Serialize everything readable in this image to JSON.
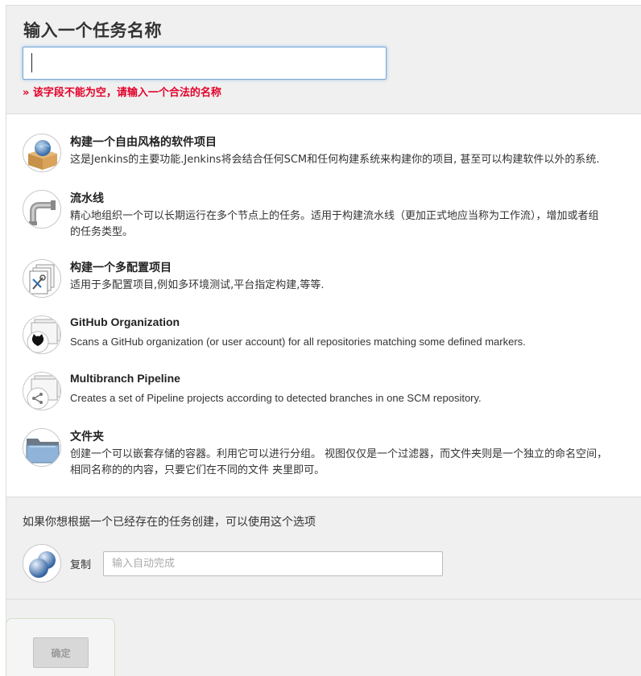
{
  "header": {
    "title": "输入一个任务名称",
    "name_input_value": "",
    "error": "» 该字段不能为空，请输入一个合法的名称"
  },
  "items": [
    {
      "name": "构建一个自由风格的软件项目",
      "description": "这是Jenkins的主要功能.Jenkins将会结合任何SCM和任何构建系统来构建你的项目, 甚至可以构建软件以外的系统.",
      "icon": "freestyle-box-icon"
    },
    {
      "name": "流水线",
      "description": "精心地组织一个可以长期运行在多个节点上的任务。适用于构建流水线（更加正式地应当称为工作流），增加或者组\n的任务类型。",
      "icon": "pipeline-icon"
    },
    {
      "name": "构建一个多配置项目",
      "description": "适用于多配置项目,例如多环境测试,平台指定构建,等等.",
      "icon": "multi-config-icon"
    },
    {
      "name": "GitHub Organization",
      "description": "Scans a GitHub organization (or user account) for all repositories matching some defined markers.",
      "icon": "github-org-icon"
    },
    {
      "name": "Multibranch Pipeline",
      "description": "Creates a set of Pipeline projects according to detected branches in one SCM repository.",
      "icon": "multibranch-icon"
    },
    {
      "name": "文件夹",
      "description": "创建一个可以嵌套存储的容器。利用它可以进行分组。 视图仅仅是一个过滤器，而文件夹则是一个独立的命名空间，\n相同名称的的内容，只要它们在不同的文件 夹里即可。",
      "icon": "folder-icon"
    }
  ],
  "copy": {
    "heading": "如果你想根据一个已经存在的任务创建，可以使用这个选项",
    "label": "复制",
    "placeholder": "输入自动完成",
    "icon": "copy-spheres-icon"
  },
  "footer": {
    "ok_label": "确定"
  },
  "colors": {
    "error": "#e3002a",
    "input_focus": "#7ba7d7",
    "band": "#f0f0f0"
  }
}
